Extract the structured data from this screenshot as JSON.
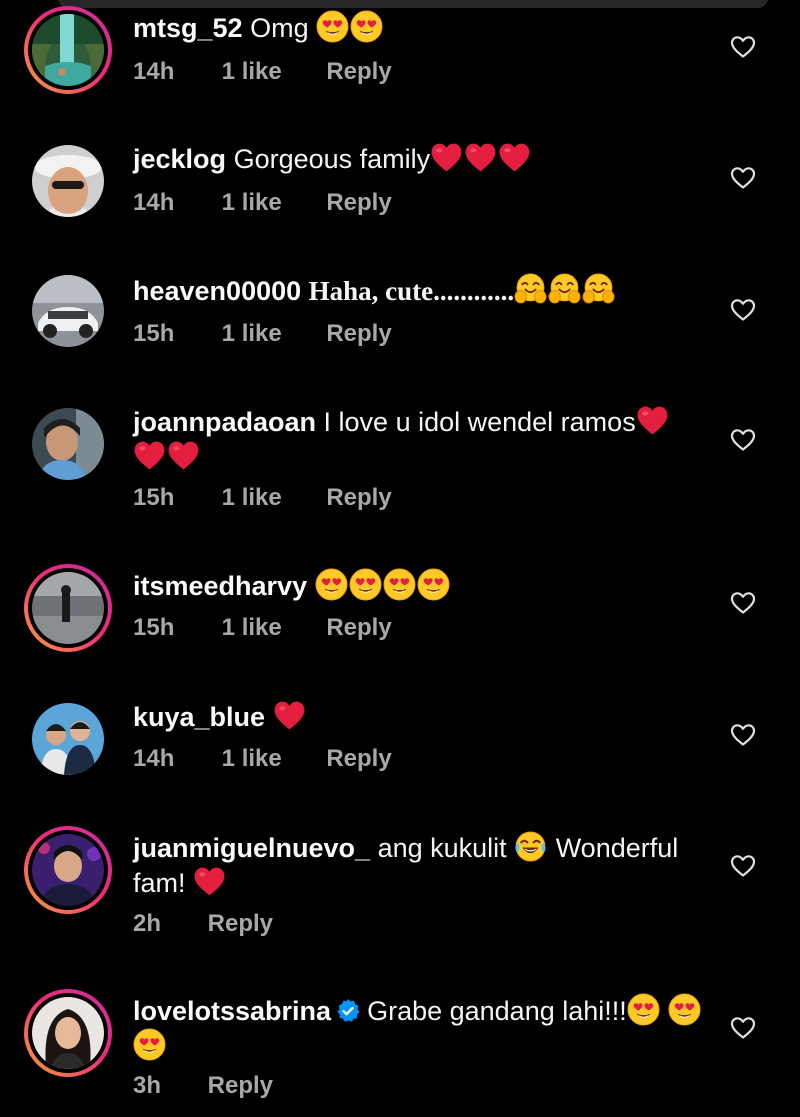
{
  "icons": {
    "like": "heart-outline-icon",
    "heart": "red-heart-emoji",
    "heart_eyes": "smiling-face-with-heart-eyes-emoji",
    "hugging": "hugging-face-emoji",
    "joy": "face-with-tears-of-joy-emoji",
    "verified": "verified-badge-icon"
  },
  "colors": {
    "background": "#000000",
    "meta_text": "#a8a8a8",
    "heart": "#e41e3f",
    "verified": "#0095f6"
  },
  "comments": [
    {
      "username": "mtsg_52",
      "text": "Omg",
      "time": "14h",
      "likes": "1 like",
      "reply": "Reply"
    },
    {
      "username": "jecklog",
      "text": "Gorgeous family",
      "time": "14h",
      "likes": "1 like",
      "reply": "Reply"
    },
    {
      "username": "heaven00000",
      "text": "Haha, cute............",
      "time": "15h",
      "likes": "1 like",
      "reply": "Reply"
    },
    {
      "username": "joannpadaoan",
      "text": "I love u idol wendel ramos",
      "time": "15h",
      "likes": "1 like",
      "reply": "Reply"
    },
    {
      "username": "itsmeedharvy",
      "text": "",
      "time": "15h",
      "likes": "1 like",
      "reply": "Reply"
    },
    {
      "username": "kuya_blue",
      "text": "",
      "time": "14h",
      "likes": "1 like",
      "reply": "Reply"
    },
    {
      "username": "juanmiguelnuevo_",
      "text": "ang kukulit",
      "text2": "Wonderful fam!",
      "time": "2h",
      "reply": "Reply"
    },
    {
      "username": "lovelotssabrina",
      "text": "Grabe gandang lahi!!!",
      "time": "3h",
      "reply": "Reply"
    }
  ]
}
